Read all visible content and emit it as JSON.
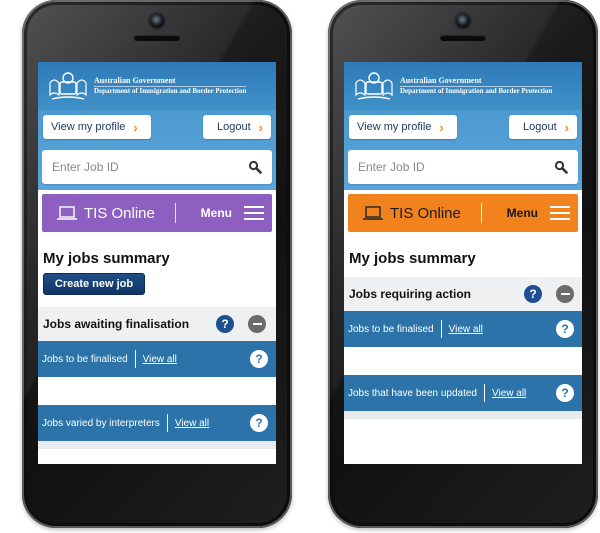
{
  "colors": {
    "left_accent": "#8d5fc0",
    "right_accent": "#f2821e",
    "header_blue": "#3a88c2",
    "row_blue": "#2b73a8",
    "button_navy": "#16406f"
  },
  "icons": {
    "search": "magnifier-icon",
    "laptop": "laptop-icon",
    "menu": "hamburger-icon",
    "help": "question-circle-icon",
    "collapse": "minus-circle-icon",
    "chevron": "chevron-right-icon"
  },
  "header": {
    "gov_line1": "Australian Government",
    "gov_line2": "Department of Immigration and Border Protection"
  },
  "nav": {
    "profile_label": "View my profile",
    "logout_label": "Logout",
    "chevron": "›"
  },
  "search": {
    "placeholder": "Enter Job ID"
  },
  "app_bar": {
    "title": "TIS Online",
    "menu_label": "Menu"
  },
  "left": {
    "summary_title": "My jobs summary",
    "create_button": "Create new job",
    "section_title": "Jobs awaiting finalisation",
    "rows": [
      {
        "label": "Jobs to be finalised",
        "link": "View all"
      },
      {
        "label": "Jobs varied by interpreters",
        "link": "View all"
      }
    ]
  },
  "right": {
    "summary_title": "My jobs summary",
    "section_title": "Jobs requiring action",
    "rows": [
      {
        "label": "Jobs to be finalised",
        "link": "View all"
      },
      {
        "label": "Jobs that have been updated",
        "link": "View all"
      }
    ]
  },
  "help_glyph": "?"
}
